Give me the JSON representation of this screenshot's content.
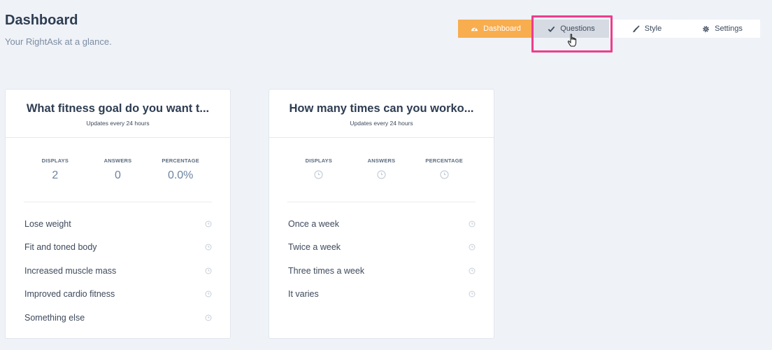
{
  "header": {
    "title": "Dashboard",
    "subtitle": "Your RightAsk at a glance."
  },
  "nav": {
    "items": [
      {
        "label": "Dashboard",
        "icon": "speedometer-icon",
        "state": "active"
      },
      {
        "label": "Questions",
        "icon": "checkmark-icon",
        "state": "hover"
      },
      {
        "label": "Style",
        "icon": "brush-icon",
        "state": "normal"
      },
      {
        "label": "Settings",
        "icon": "gear-icon",
        "state": "normal"
      }
    ]
  },
  "colors": {
    "background": "#eff2f7",
    "accent": "#f8ad4f",
    "highlight": "#ec3d8c",
    "hover": "#d6dbe3"
  },
  "cards": [
    {
      "title": "What fitness goal do you want t...",
      "subtitle": "Updates every 24 hours",
      "stats": {
        "displays_label": "DISPLAYS",
        "answers_label": "ANSWERS",
        "percentage_label": "PERCENTAGE",
        "displays": "2",
        "answers": "0",
        "percentage": "0.0%"
      },
      "answers": [
        "Lose weight",
        "Fit and toned body",
        "Increased muscle mass",
        "Improved cardio fitness",
        "Something else"
      ]
    },
    {
      "title": "How many times can you worko...",
      "subtitle": "Updates every 24 hours",
      "stats": {
        "displays_label": "DISPLAYS",
        "answers_label": "ANSWERS",
        "percentage_label": "PERCENTAGE",
        "loading_icon": "clock-icon"
      },
      "answers": [
        "Once a week",
        "Twice a week",
        "Three times a week",
        "It varies"
      ]
    }
  ]
}
